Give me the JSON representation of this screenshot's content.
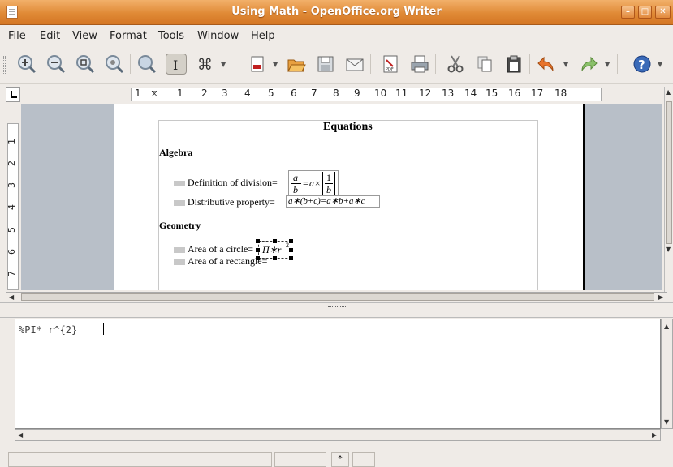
{
  "window": {
    "title": "Using Math - OpenOffice.org Writer"
  },
  "menu": [
    "File",
    "Edit",
    "View",
    "Format",
    "Tools",
    "Window",
    "Help"
  ],
  "toolbar": {
    "icons": [
      "zoom-in-icon",
      "zoom-out-icon",
      "zoom-100-icon",
      "zoom-page-icon",
      "zoom-icon",
      "text-cursor-icon",
      "command-icon",
      "format-icon",
      "open-icon",
      "save-icon",
      "email-icon",
      "pdf-icon",
      "print-icon",
      "cut-icon",
      "copy-icon",
      "paste-icon",
      "undo-icon",
      "redo-icon",
      "help-icon"
    ]
  },
  "ruler": {
    "ticks": [
      "1",
      "1",
      "2",
      "3",
      "4",
      "5",
      "6",
      "7",
      "8",
      "9",
      "10",
      "11",
      "12",
      "13",
      "14",
      "15",
      "16",
      "17",
      "18"
    ],
    "vticks": [
      "1",
      "2",
      "3",
      "4",
      "5",
      "6",
      "7"
    ]
  },
  "document": {
    "heading": "Equations",
    "algebra_heading": "Algebra",
    "algebra_items": [
      {
        "label": "Definition of division="
      },
      {
        "label": "Distributive property=",
        "formula": "a∗(b+c)=a∗b+a∗c"
      }
    ],
    "division_formula": {
      "a": "a",
      "b": "b",
      "eq": "=",
      "ax": "a×",
      "one": "1",
      "b2": "b"
    },
    "geometry_heading": "Geometry",
    "geometry_items": [
      {
        "label": "Area of a circle=",
        "formula": "Π∗r",
        "sup": "2"
      },
      {
        "label": "Area of a rectangle="
      }
    ]
  },
  "formula_editor": {
    "text": "%PI* r^{2}"
  },
  "statusbar": {
    "mode": "*"
  },
  "colors": {
    "titlebar": "#e08a36",
    "background": "#efebe7",
    "doc_background": "#b8bfc8"
  }
}
